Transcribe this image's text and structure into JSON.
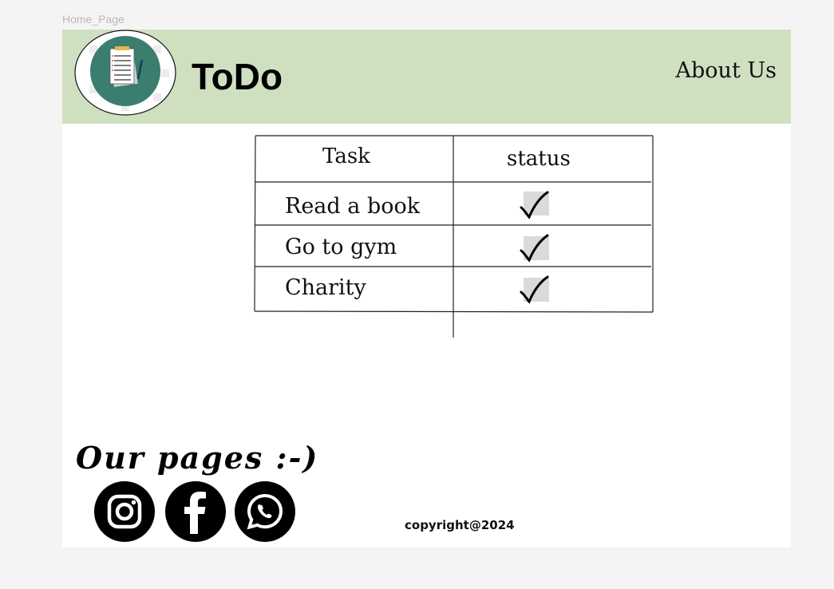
{
  "frame": {
    "label": "Home_Page"
  },
  "header": {
    "brand": "ToDo",
    "nav_about": "About Us",
    "background_color": "#cfe0c0"
  },
  "table": {
    "headers": [
      "Task",
      "status"
    ],
    "rows": [
      {
        "task": "Read a book",
        "status_icon": "checkmark-icon",
        "done": true
      },
      {
        "task": "Go to gym",
        "status_icon": "checkmark-icon",
        "done": true
      },
      {
        "task": "Charity",
        "status_icon": "checkmark-icon",
        "done": true
      }
    ]
  },
  "footer": {
    "pages_title": "Our pages :-)",
    "social": [
      "instagram-icon",
      "facebook-icon",
      "whatsapp-icon"
    ],
    "copyright": "copyright@2024"
  },
  "colors": {
    "logo_teal": "#3b7d6e",
    "page_bg": "#f4f4f4"
  }
}
